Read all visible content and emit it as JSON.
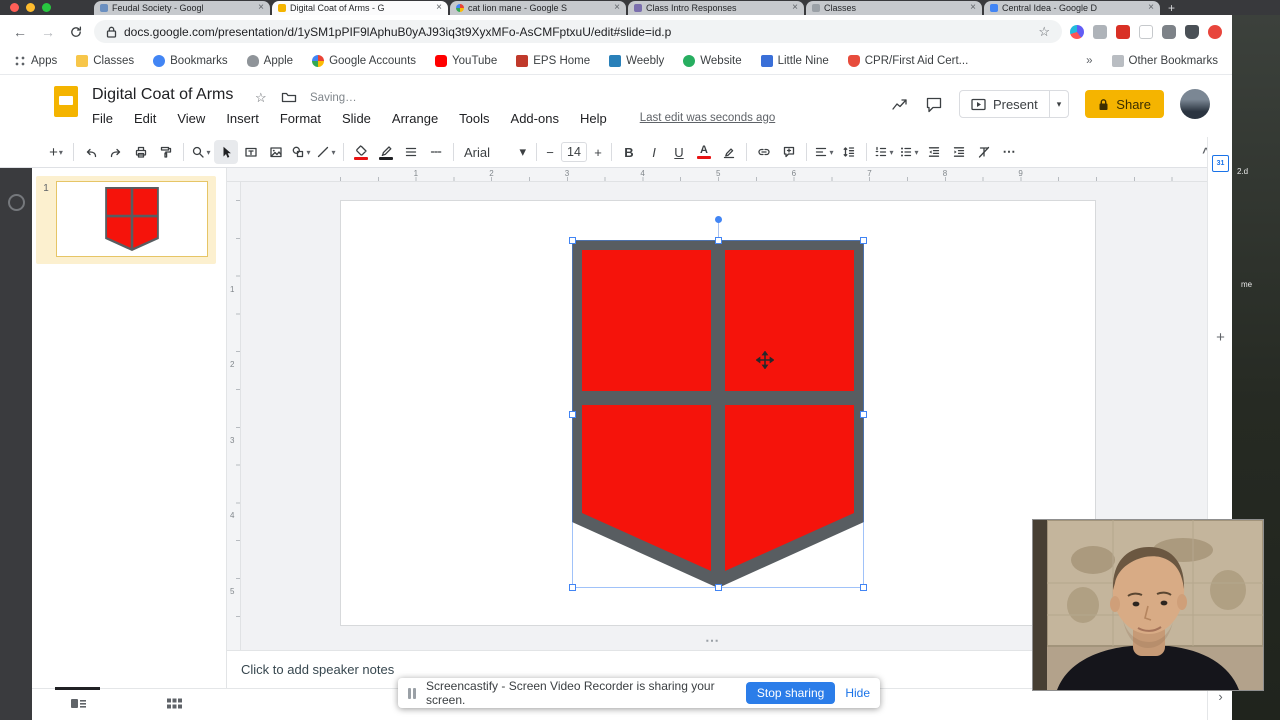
{
  "glyphs": {
    "close": "×",
    "plus": "+",
    "minus": "−",
    "back": "←",
    "forward": "→",
    "chevron_down": "▾",
    "chevron_right": "›",
    "star": "☆",
    "overflow": "»",
    "more": "⋯",
    "collapse": "^",
    "dots_handle": "⋯"
  },
  "colors": {
    "shield_red": "#f5130b",
    "shield_gray": "#585d61",
    "selection_blue": "#4285f4",
    "share_yellow": "#f5b400",
    "slides_yellow": "#f4b400",
    "link_blue": "#1a73e8"
  },
  "browser": {
    "tabs": [
      {
        "title": "Feudal Society - Googl"
      },
      {
        "title": "Digital Coat of Arms - G"
      },
      {
        "title": "cat lion mane - Google S"
      },
      {
        "title": "Class Intro Responses"
      },
      {
        "title": "Classes"
      },
      {
        "title": "Central Idea - Google D"
      }
    ],
    "url": "docs.google.com/presentation/d/1ySM1pPIF9lAphuB0yAJ93iq3t9XyxMFo-AsCMFptxuU/edit#slide=id.p",
    "bookmarks": {
      "apps": "Apps",
      "items": [
        "Classes",
        "Bookmarks",
        "Apple",
        "Google Accounts",
        "YouTube",
        "EPS Home",
        "Weebly",
        "Website",
        "Little Nine",
        "CPR/First Aid Cert..."
      ],
      "other": "Other Bookmarks"
    }
  },
  "app": {
    "title": "Digital Coat of Arms",
    "saving": "Saving…",
    "menus": [
      "File",
      "Edit",
      "View",
      "Insert",
      "Format",
      "Slide",
      "Arrange",
      "Tools",
      "Add-ons",
      "Help"
    ],
    "last_edit": "Last edit was seconds ago",
    "present": "Present",
    "share": "Share",
    "toolbar": {
      "font_family": "Arial",
      "font_size": "14",
      "bold": "B",
      "italic": "I",
      "underline": "U",
      "text_color": "A"
    },
    "filmstrip": {
      "slide_number": "1"
    },
    "rulers": {
      "horizontal": [
        "1",
        "2",
        "3",
        "4",
        "5",
        "6",
        "7",
        "8",
        "9"
      ],
      "vertical": [
        "1",
        "2",
        "3",
        "4",
        "5"
      ]
    },
    "notes_placeholder": "Click to add speaker notes",
    "side_panel": {
      "calendar_day": "31"
    }
  },
  "notification": {
    "text": "Screencastify - Screen Video Recorder is sharing your screen.",
    "stop_button": "Stop sharing",
    "hide_button": "Hide"
  },
  "desktop": {
    "labels": [
      "2.d",
      "me"
    ]
  }
}
